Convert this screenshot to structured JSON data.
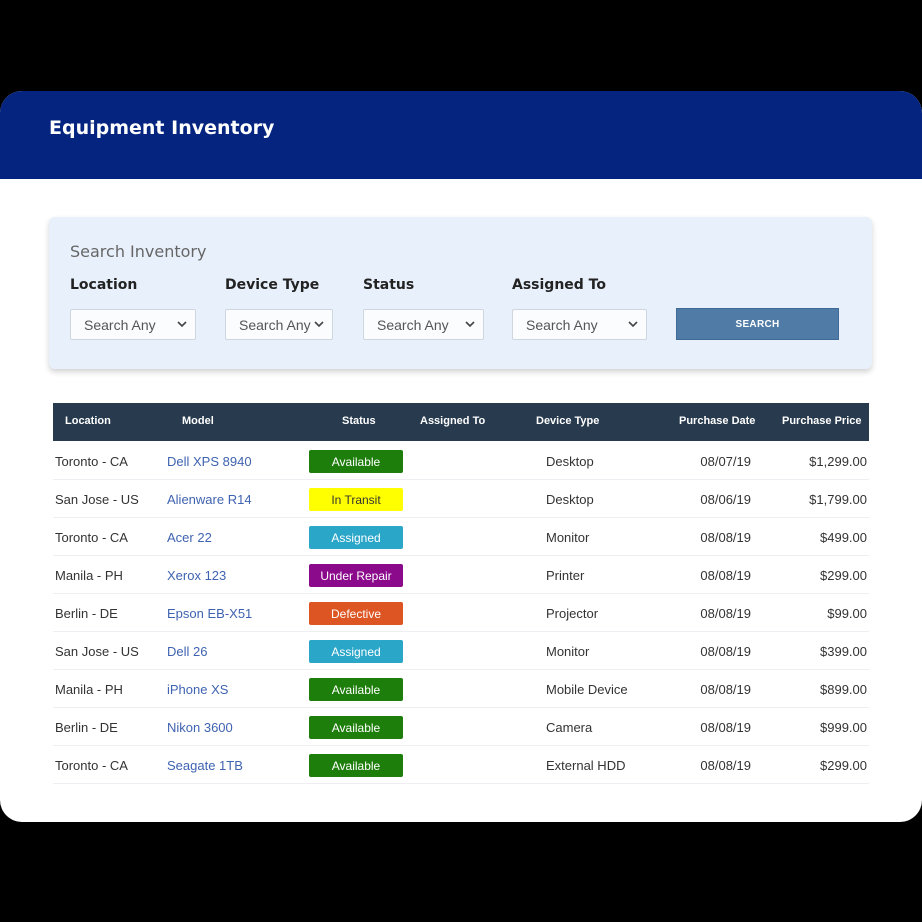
{
  "header": {
    "title": "Equipment Inventory"
  },
  "search": {
    "title": "Search Inventory",
    "filters": [
      {
        "label": "Location",
        "value": "Search Any"
      },
      {
        "label": "Device Type",
        "value": "Search Any"
      },
      {
        "label": "Status",
        "value": "Search Any"
      },
      {
        "label": "Assigned To",
        "value": "Search Any"
      }
    ],
    "button_label": "SEARCH"
  },
  "table": {
    "columns": [
      "Location",
      "Model",
      "Status",
      "Assigned To",
      "Device Type",
      "Purchase Date",
      "Purchase Price"
    ],
    "rows": [
      {
        "location": "Toronto - CA",
        "model": "Dell XPS 8940",
        "status": "Available",
        "assigned_to": "",
        "device_type": "Desktop",
        "purchase_date": "08/07/19",
        "purchase_price": "$1,299.00"
      },
      {
        "location": "San Jose - US",
        "model": "Alienware R14",
        "status": "In Transit",
        "assigned_to": "",
        "device_type": "Desktop",
        "purchase_date": "08/06/19",
        "purchase_price": "$1,799.00"
      },
      {
        "location": "Toronto - CA",
        "model": "Acer 22",
        "status": "Assigned",
        "assigned_to": "",
        "device_type": "Monitor",
        "purchase_date": "08/08/19",
        "purchase_price": "$499.00"
      },
      {
        "location": "Manila - PH",
        "model": "Xerox 123",
        "status": "Under Repair",
        "assigned_to": "",
        "device_type": "Printer",
        "purchase_date": "08/08/19",
        "purchase_price": "$299.00"
      },
      {
        "location": "Berlin - DE",
        "model": "Epson EB-X51",
        "status": "Defective",
        "assigned_to": "",
        "device_type": "Projector",
        "purchase_date": "08/08/19",
        "purchase_price": "$99.00"
      },
      {
        "location": "San Jose - US",
        "model": "Dell 26",
        "status": "Assigned",
        "assigned_to": "",
        "device_type": "Monitor",
        "purchase_date": "08/08/19",
        "purchase_price": "$399.00"
      },
      {
        "location": "Manila - PH",
        "model": "iPhone XS",
        "status": "Available",
        "assigned_to": "",
        "device_type": "Mobile Device",
        "purchase_date": "08/08/19",
        "purchase_price": "$899.00"
      },
      {
        "location": "Berlin - DE",
        "model": "Nikon 3600",
        "status": "Available",
        "assigned_to": "",
        "device_type": "Camera",
        "purchase_date": "08/08/19",
        "purchase_price": "$999.00"
      },
      {
        "location": "Toronto - CA",
        "model": "Seagate 1TB",
        "status": "Available",
        "assigned_to": "",
        "device_type": "External HDD",
        "purchase_date": "08/08/19",
        "purchase_price": "$299.00"
      }
    ]
  },
  "status_colors": {
    "Available": {
      "bg": "#1e7e0c",
      "fg": "#ffffff"
    },
    "In Transit": {
      "bg": "#ffff00",
      "fg": "#333333"
    },
    "Assigned": {
      "bg": "#2aa6c9",
      "fg": "#ffffff"
    },
    "Under Repair": {
      "bg": "#8b0a8c",
      "fg": "#ffffff"
    },
    "Defective": {
      "bg": "#dd5522",
      "fg": "#ffffff"
    }
  },
  "colors": {
    "header_bg": "#04247f",
    "table_head_bg": "#273a4e",
    "search_button": "#4f7ba6"
  },
  "icons": {
    "select_chevron": "chevron-down-icon"
  }
}
